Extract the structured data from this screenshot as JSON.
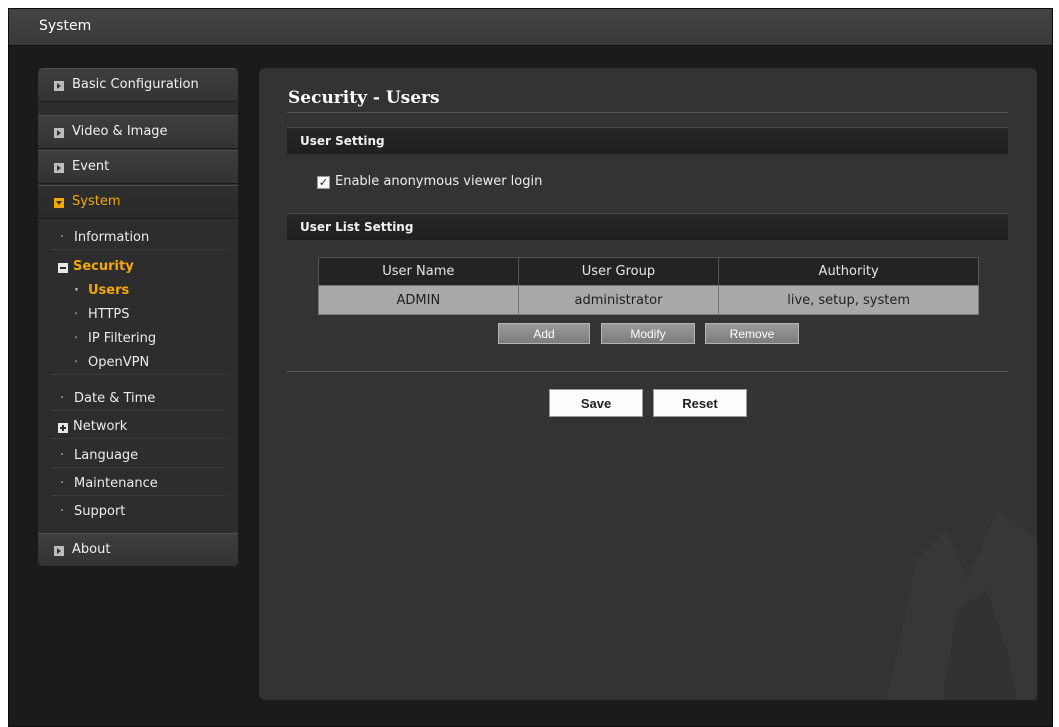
{
  "window": {
    "title": "System"
  },
  "sidebar": {
    "basic_configuration": "Basic Configuration",
    "video_image": "Video & Image",
    "event": "Event",
    "system": "System",
    "submenu": {
      "information": "Information",
      "security": "Security",
      "security_children": [
        "Users",
        "HTTPS",
        "IP Filtering",
        "OpenVPN"
      ],
      "date_time": "Date & Time",
      "network": "Network",
      "language": "Language",
      "maintenance": "Maintenance",
      "support": "Support"
    },
    "about": "About"
  },
  "main": {
    "title": "Security - Users",
    "user_setting": {
      "header": "User Setting",
      "anonymous_login_label": "Enable anonymous viewer login",
      "anonymous_login_checked": true
    },
    "user_list_setting": {
      "header": "User List Setting",
      "columns": [
        "User Name",
        "User Group",
        "Authority"
      ],
      "rows": [
        [
          "ADMIN",
          "administrator",
          "live, setup, system"
        ]
      ],
      "buttons": {
        "add": "Add",
        "modify": "Modify",
        "remove": "Remove"
      }
    },
    "actions": {
      "save": "Save",
      "reset": "Reset"
    }
  },
  "colors": {
    "accent": "#f5a800",
    "background": "#1b1b1b",
    "panel": "#333333",
    "table_row": "#a9a9a9"
  }
}
